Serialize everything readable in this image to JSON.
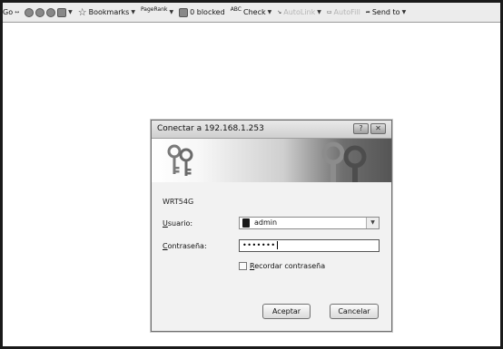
{
  "toolbar": {
    "go_label": "Go",
    "bookmarks_label": "Bookmarks",
    "pagerank_label": "PageRank",
    "blocked_label": "0 blocked",
    "check_sup": "ABC",
    "check_label": "Check",
    "autolink_label": "AutoLink",
    "autofill_label": "AutoFill",
    "sendto_label": "Send to"
  },
  "dialog": {
    "title": "Conectar a 192.168.1.253",
    "realm": "WRT54G",
    "user_label_u": "U",
    "user_label_rest": "suario:",
    "user_value": "admin",
    "password_label_u": "C",
    "password_label_rest": "ontraseña:",
    "password_value": "•••••••",
    "remember_label_u": "R",
    "remember_label_rest": "ecordar contraseña",
    "remember_checked": false,
    "accept_label": "Aceptar",
    "cancel_label": "Cancelar"
  }
}
